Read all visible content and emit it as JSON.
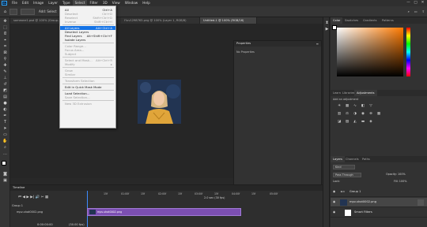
{
  "menubar": {
    "items": [
      "File",
      "Edit",
      "Image",
      "Layer",
      "Type",
      "Select",
      "Filter",
      "3D",
      "View",
      "Window",
      "Help"
    ],
    "active": "Select"
  },
  "options_bar": {
    "add_select": "Add: Select",
    "feather": "Feather: 0 px"
  },
  "tabs": [
    {
      "label": "someone1.psd @ 100% (Group...",
      "active": false
    },
    {
      "label": "I'luv1298763.png @ 100% (Layer 1, RGB/8)",
      "active": false
    },
    {
      "label": "Untitled-1 @ 100% (RGB/16)",
      "active": true
    }
  ],
  "select_menu": {
    "items": [
      {
        "label": "All",
        "shortcut": "Ctrl+A",
        "state": "normal"
      },
      {
        "label": "Deselect",
        "shortcut": "Ctrl+D",
        "state": "disabled"
      },
      {
        "label": "Reselect",
        "shortcut": "Shift+Ctrl+D",
        "state": "disabled"
      },
      {
        "label": "Inverse",
        "shortcut": "Shift+Ctrl+I",
        "state": "disabled"
      },
      {
        "sep": true
      },
      {
        "label": "All Layers",
        "shortcut": "Alt+Ctrl+A",
        "state": "highlighted"
      },
      {
        "label": "Deselect Layers",
        "shortcut": "",
        "state": "normal"
      },
      {
        "label": "Find Layers",
        "shortcut": "Alt+Shift+Ctrl+F",
        "state": "normal"
      },
      {
        "label": "Isolate Layers",
        "shortcut": "",
        "state": "normal"
      },
      {
        "sep": true
      },
      {
        "label": "Color Range...",
        "shortcut": "",
        "state": "disabled"
      },
      {
        "label": "Focus Area...",
        "shortcut": "",
        "state": "disabled"
      },
      {
        "label": "Subject",
        "shortcut": "",
        "state": "disabled"
      },
      {
        "sep": true
      },
      {
        "label": "Select and Mask...",
        "shortcut": "Alt+Ctrl+R",
        "state": "disabled"
      },
      {
        "label": "Modify",
        "shortcut": "▸",
        "state": "disabled"
      },
      {
        "sep": true
      },
      {
        "label": "Grow",
        "shortcut": "",
        "state": "disabled"
      },
      {
        "label": "Similar",
        "shortcut": "",
        "state": "disabled"
      },
      {
        "sep": true
      },
      {
        "label": "Transform Selection",
        "shortcut": "",
        "state": "disabled"
      },
      {
        "sep": true
      },
      {
        "label": "Edit in Quick Mask Mode",
        "shortcut": "",
        "state": "normal"
      },
      {
        "sep": true
      },
      {
        "label": "Load Selection...",
        "shortcut": "",
        "state": "normal"
      },
      {
        "label": "Save Selection...",
        "shortcut": "",
        "state": "disabled"
      },
      {
        "sep": true
      },
      {
        "label": "New 3D Extrusion",
        "shortcut": "",
        "state": "disabled"
      }
    ]
  },
  "properties": {
    "title": "Properties",
    "subtitle": "No Properties"
  },
  "color_panel": {
    "tabs": [
      "Color",
      "Swatches",
      "Gradients",
      "Patterns"
    ],
    "active": "Color"
  },
  "adjust_panel": {
    "tabs": [
      "Learn",
      "Libraries",
      "Adjustments"
    ],
    "active": "Adjustments",
    "hint": "Add an adjustment"
  },
  "layers_panel": {
    "tabs": [
      "Layers",
      "Channels",
      "Paths"
    ],
    "active": "Layers",
    "filter_label": "Kind",
    "blend_mode": "Pass Through",
    "opacity": "Opacity: 100%",
    "lock_label": "Lock:",
    "fill": "Fill: 100%",
    "layers": [
      {
        "name": "Group 1",
        "type": "group"
      },
      {
        "name": "mpv-shot0002.png",
        "type": "image"
      },
      {
        "name": "Smart Filters",
        "type": "filter"
      }
    ]
  },
  "timeline": {
    "title": "Timeline",
    "group_label": "Group 1",
    "clip_label": "mpv-shot0002.png",
    "track_label": "mpv-shot0002.png",
    "ruler": [
      "15f",
      "01:00f",
      "15f",
      "02:00f",
      "15f",
      "03:00f",
      "15f",
      "04:00f",
      "15f",
      "05:00f"
    ],
    "time": "0:00:00:00",
    "fps": "(30.00 fps)",
    "status": "2.0 sec (30 fps)"
  },
  "colors": {
    "accent": "#1473e6",
    "track": "#7c4fb2",
    "panel": "#323232",
    "background": "#282828"
  }
}
